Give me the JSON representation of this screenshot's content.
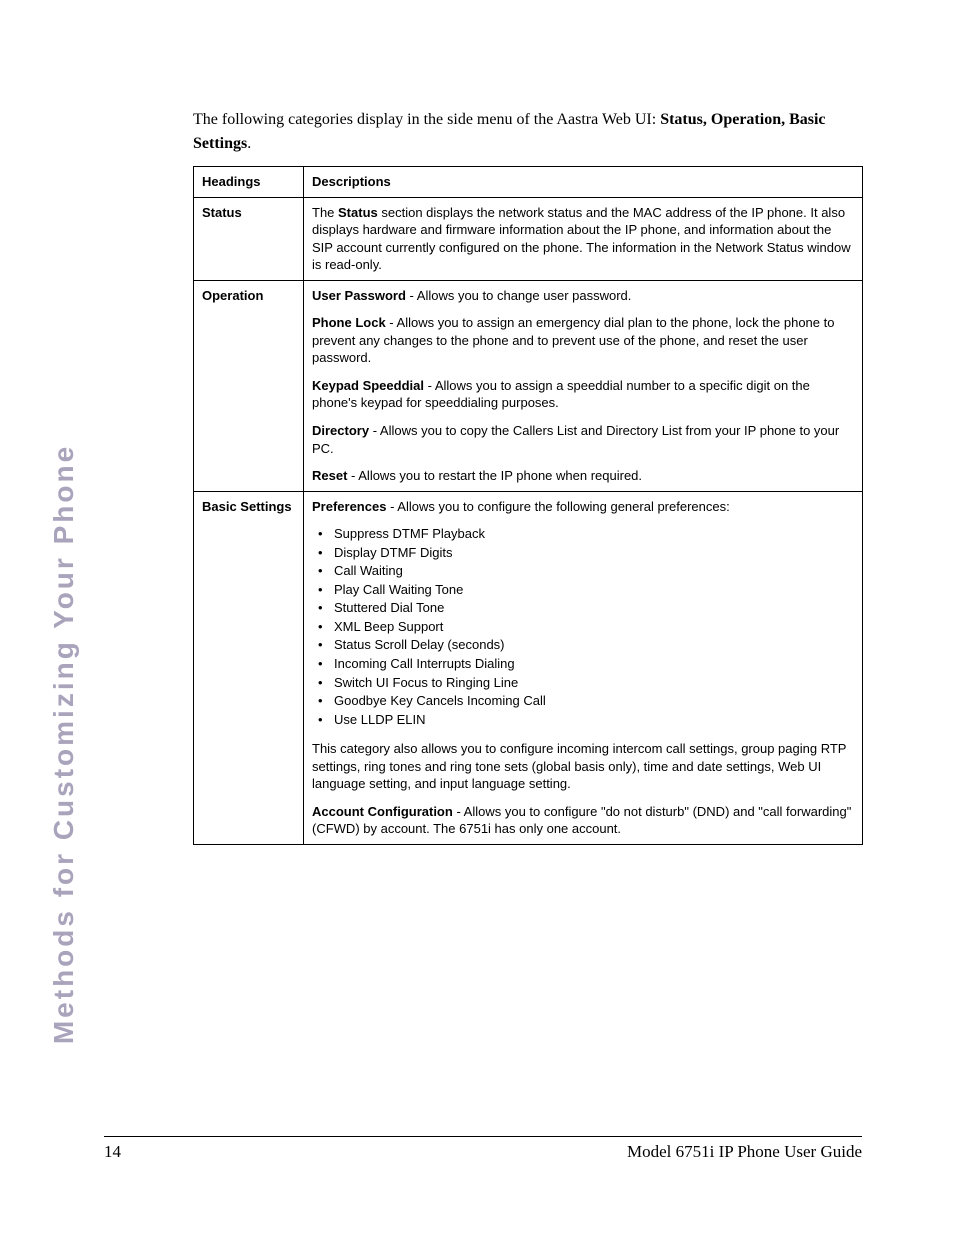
{
  "side_title": "Methods for Customizing Your Phone",
  "intro": {
    "pre": "The following categories display in the side menu of the Aastra Web UI: ",
    "bold": "Status, Operation, Basic Settings",
    "post": "."
  },
  "table": {
    "head": {
      "col1": "Headings",
      "col2": "Descriptions"
    },
    "status": {
      "heading": "Status",
      "desc_pre": "The ",
      "desc_bold": "Status",
      "desc_post": " section displays the network status and the MAC address of the IP phone. It also displays hardware and firmware information about the IP phone, and information about the SIP account currently configured on the phone. The information in the Network Status window is read-only."
    },
    "operation": {
      "heading": "Operation",
      "user_password_b": "User Password",
      "user_password_t": " - Allows you to change user password.",
      "phone_lock_b": "Phone Lock",
      "phone_lock_t": " - Allows you to assign an emergency dial plan to the phone, lock the phone to prevent any changes to the phone and to prevent use of the phone, and reset the user password.",
      "keypad_b": "Keypad Speeddial",
      "keypad_t": " - Allows you to assign a speeddial number to a specific digit on the phone's keypad for speeddialing purposes.",
      "directory_b": "Directory",
      "directory_t": " - Allows you to copy the Callers List and Directory List from your IP phone to your PC.",
      "reset_b": "Reset",
      "reset_t": " - Allows you to restart the IP phone when required."
    },
    "basic": {
      "heading": "Basic Settings",
      "prefs_b": "Preferences",
      "prefs_t": " - Allows you to configure the following general preferences:",
      "items": [
        "Suppress DTMF Playback",
        "Display DTMF Digits",
        "Call Waiting",
        "Play Call Waiting Tone",
        "Stuttered Dial Tone",
        "XML Beep Support",
        "Status Scroll Delay (seconds)",
        "Incoming Call Interrupts Dialing",
        "Switch UI Focus to Ringing Line",
        "Goodbye Key Cancels Incoming Call",
        "Use LLDP ELIN"
      ],
      "prefs_more": "This category also allows you to configure incoming intercom call settings, group paging RTP settings, ring tones and ring tone sets (global basis only), time and date settings, Web UI language setting, and input language setting.",
      "acct_b": "Account Configuration",
      "acct_t": " - Allows you to configure \"do not disturb\" (DND) and \"call forwarding\" (CFWD) by account. The 6751i has only one account."
    }
  },
  "footer": {
    "page": "14",
    "title": "Model 6751i IP Phone User Guide"
  }
}
